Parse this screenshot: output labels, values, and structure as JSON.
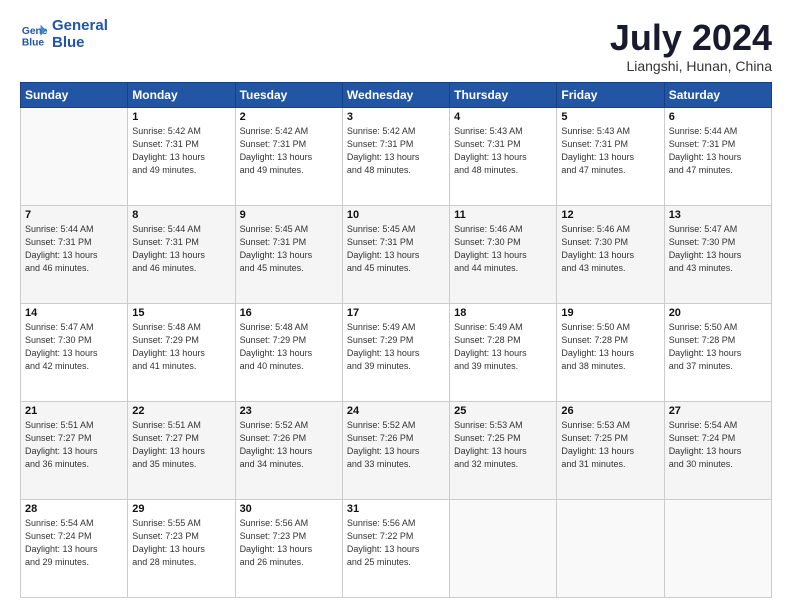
{
  "header": {
    "logo_line1": "General",
    "logo_line2": "Blue",
    "month_year": "July 2024",
    "location": "Liangshi, Hunan, China"
  },
  "weekdays": [
    "Sunday",
    "Monday",
    "Tuesday",
    "Wednesday",
    "Thursday",
    "Friday",
    "Saturday"
  ],
  "weeks": [
    [
      {
        "day": "",
        "info": ""
      },
      {
        "day": "1",
        "info": "Sunrise: 5:42 AM\nSunset: 7:31 PM\nDaylight: 13 hours\nand 49 minutes."
      },
      {
        "day": "2",
        "info": "Sunrise: 5:42 AM\nSunset: 7:31 PM\nDaylight: 13 hours\nand 49 minutes."
      },
      {
        "day": "3",
        "info": "Sunrise: 5:42 AM\nSunset: 7:31 PM\nDaylight: 13 hours\nand 48 minutes."
      },
      {
        "day": "4",
        "info": "Sunrise: 5:43 AM\nSunset: 7:31 PM\nDaylight: 13 hours\nand 48 minutes."
      },
      {
        "day": "5",
        "info": "Sunrise: 5:43 AM\nSunset: 7:31 PM\nDaylight: 13 hours\nand 47 minutes."
      },
      {
        "day": "6",
        "info": "Sunrise: 5:44 AM\nSunset: 7:31 PM\nDaylight: 13 hours\nand 47 minutes."
      }
    ],
    [
      {
        "day": "7",
        "info": "Sunrise: 5:44 AM\nSunset: 7:31 PM\nDaylight: 13 hours\nand 46 minutes."
      },
      {
        "day": "8",
        "info": "Sunrise: 5:44 AM\nSunset: 7:31 PM\nDaylight: 13 hours\nand 46 minutes."
      },
      {
        "day": "9",
        "info": "Sunrise: 5:45 AM\nSunset: 7:31 PM\nDaylight: 13 hours\nand 45 minutes."
      },
      {
        "day": "10",
        "info": "Sunrise: 5:45 AM\nSunset: 7:31 PM\nDaylight: 13 hours\nand 45 minutes."
      },
      {
        "day": "11",
        "info": "Sunrise: 5:46 AM\nSunset: 7:30 PM\nDaylight: 13 hours\nand 44 minutes."
      },
      {
        "day": "12",
        "info": "Sunrise: 5:46 AM\nSunset: 7:30 PM\nDaylight: 13 hours\nand 43 minutes."
      },
      {
        "day": "13",
        "info": "Sunrise: 5:47 AM\nSunset: 7:30 PM\nDaylight: 13 hours\nand 43 minutes."
      }
    ],
    [
      {
        "day": "14",
        "info": "Sunrise: 5:47 AM\nSunset: 7:30 PM\nDaylight: 13 hours\nand 42 minutes."
      },
      {
        "day": "15",
        "info": "Sunrise: 5:48 AM\nSunset: 7:29 PM\nDaylight: 13 hours\nand 41 minutes."
      },
      {
        "day": "16",
        "info": "Sunrise: 5:48 AM\nSunset: 7:29 PM\nDaylight: 13 hours\nand 40 minutes."
      },
      {
        "day": "17",
        "info": "Sunrise: 5:49 AM\nSunset: 7:29 PM\nDaylight: 13 hours\nand 39 minutes."
      },
      {
        "day": "18",
        "info": "Sunrise: 5:49 AM\nSunset: 7:28 PM\nDaylight: 13 hours\nand 39 minutes."
      },
      {
        "day": "19",
        "info": "Sunrise: 5:50 AM\nSunset: 7:28 PM\nDaylight: 13 hours\nand 38 minutes."
      },
      {
        "day": "20",
        "info": "Sunrise: 5:50 AM\nSunset: 7:28 PM\nDaylight: 13 hours\nand 37 minutes."
      }
    ],
    [
      {
        "day": "21",
        "info": "Sunrise: 5:51 AM\nSunset: 7:27 PM\nDaylight: 13 hours\nand 36 minutes."
      },
      {
        "day": "22",
        "info": "Sunrise: 5:51 AM\nSunset: 7:27 PM\nDaylight: 13 hours\nand 35 minutes."
      },
      {
        "day": "23",
        "info": "Sunrise: 5:52 AM\nSunset: 7:26 PM\nDaylight: 13 hours\nand 34 minutes."
      },
      {
        "day": "24",
        "info": "Sunrise: 5:52 AM\nSunset: 7:26 PM\nDaylight: 13 hours\nand 33 minutes."
      },
      {
        "day": "25",
        "info": "Sunrise: 5:53 AM\nSunset: 7:25 PM\nDaylight: 13 hours\nand 32 minutes."
      },
      {
        "day": "26",
        "info": "Sunrise: 5:53 AM\nSunset: 7:25 PM\nDaylight: 13 hours\nand 31 minutes."
      },
      {
        "day": "27",
        "info": "Sunrise: 5:54 AM\nSunset: 7:24 PM\nDaylight: 13 hours\nand 30 minutes."
      }
    ],
    [
      {
        "day": "28",
        "info": "Sunrise: 5:54 AM\nSunset: 7:24 PM\nDaylight: 13 hours\nand 29 minutes."
      },
      {
        "day": "29",
        "info": "Sunrise: 5:55 AM\nSunset: 7:23 PM\nDaylight: 13 hours\nand 28 minutes."
      },
      {
        "day": "30",
        "info": "Sunrise: 5:56 AM\nSunset: 7:23 PM\nDaylight: 13 hours\nand 26 minutes."
      },
      {
        "day": "31",
        "info": "Sunrise: 5:56 AM\nSunset: 7:22 PM\nDaylight: 13 hours\nand 25 minutes."
      },
      {
        "day": "",
        "info": ""
      },
      {
        "day": "",
        "info": ""
      },
      {
        "day": "",
        "info": ""
      }
    ]
  ]
}
